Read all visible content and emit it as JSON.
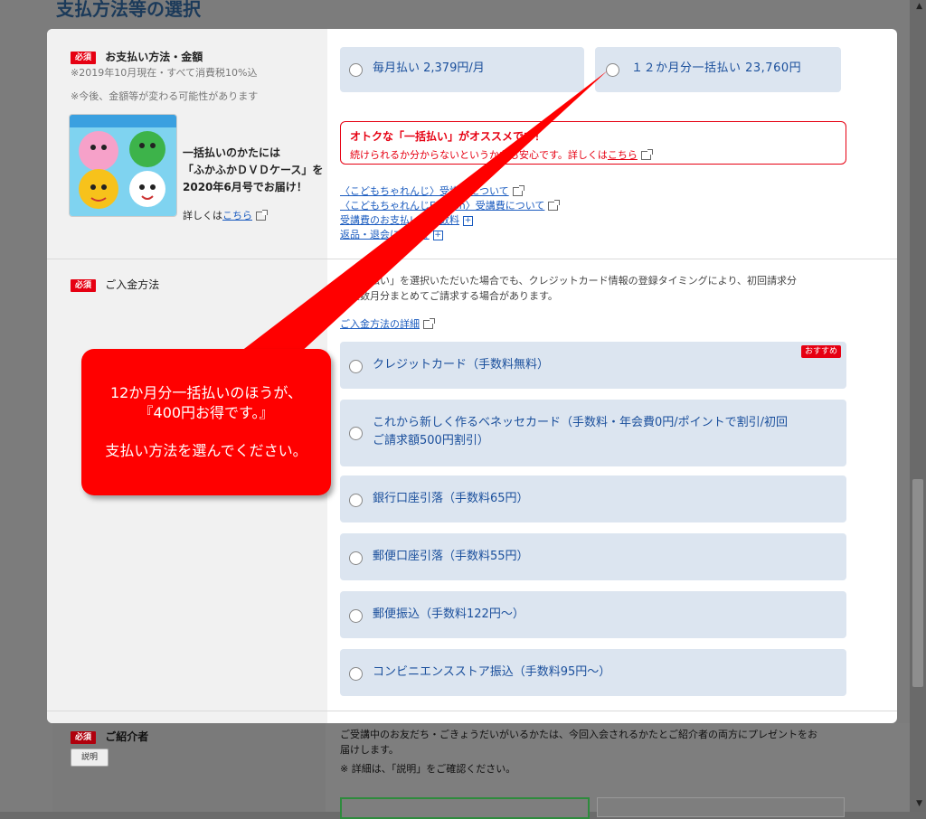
{
  "page": {
    "title": "支払方法等の選択"
  },
  "payment": {
    "required_badge": "必須",
    "label": "お支払い方法・金額",
    "note1": "※2019年10月現在・すべて消費税10%込",
    "note2": "※今後、金額等が変わる可能性があります",
    "promo_line1": "一括払いのかたには",
    "promo_line2": "「ふかふかＤＶＤケース」を",
    "promo_line3": "2020年6月号でお届け！",
    "promo_more": "詳しくは",
    "promo_link": "こちら",
    "option_monthly": "毎月払い 2,379円/月",
    "option_annual": "１２か月分一括払い 23,760円",
    "notice_title": "オトクな「一括払い」がオススメです！",
    "notice_body": "続けられるか分からないというかたも安心です。詳しくは",
    "notice_link": "こちら",
    "links": [
      "〈こどもちゃれんじ〉受講費について",
      "〈こどもちゃれんじEnglish〉受講費について",
      "受講費のお支払い・手数料",
      "返品・退会について"
    ]
  },
  "deposit": {
    "required_badge": "必須",
    "label": "ご入金方法",
    "desc_line1": "「毎月払い」を選択いただいた場合でも、クレジットカード情報の登録タイミングにより、初回請求分",
    "desc_line2": "は複数月分まとめてご請求する場合があります。",
    "detail_link": "ご入金方法の詳細",
    "recommended": "おすすめ",
    "options": [
      "クレジットカード（手数料無料）",
      "これから新しく作るベネッセカード（手数料・年会費0円/ポイントで割引/初回",
      "ご請求額500円割引）",
      "銀行口座引落（手数料65円）",
      "郵便口座引落（手数料55円）",
      "郵便振込（手数料122円〜）",
      "コンビニエンスストア振込（手数料95円〜）"
    ]
  },
  "referrer": {
    "required_badge": "必須",
    "label": "ご紹介者",
    "explain_button": "説明",
    "desc_line1": "ご受講中のお友だち・ごきょうだいがいるかたは、今回入会されるかたとご紹介者の両方にプレゼントをお",
    "desc_line2": "届けします。",
    "desc_line3": "※ 詳細は、「説明」をご確認ください。"
  },
  "callout": {
    "line1": "12か月分一括払いのほうが、",
    "line2": "『400円お得です。』",
    "line3": "支払い方法を選んでください。"
  },
  "colors": {
    "accent_red": "#e60012",
    "option_bg": "#dce5f0",
    "link_blue": "#1a5bbf"
  }
}
